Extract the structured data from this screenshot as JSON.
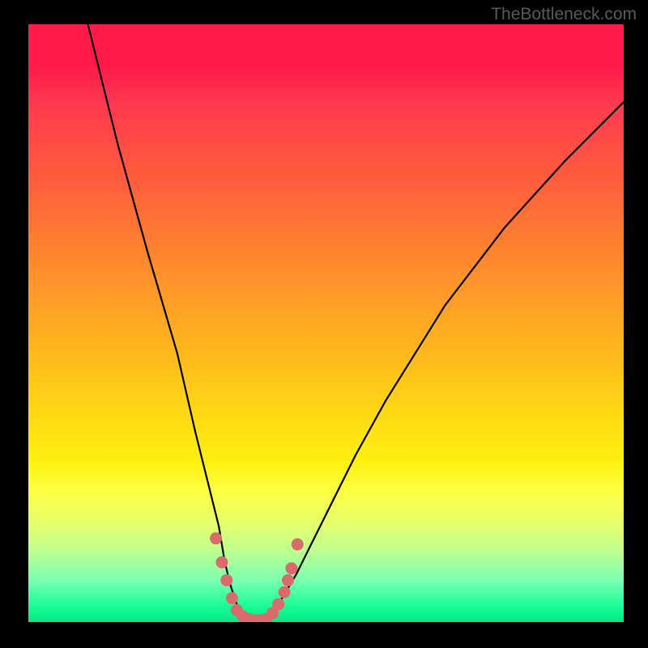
{
  "watermark": "TheBottleneck.com",
  "chart_data": {
    "type": "line",
    "title": "",
    "xlabel": "",
    "ylabel": "",
    "xlim": [
      0,
      100
    ],
    "ylim": [
      0,
      100
    ],
    "gradient": {
      "top_color": "#ff1a4a",
      "mid_color": "#fff010",
      "bottom_color": "#00e886"
    },
    "curve": {
      "description": "V-shaped bottleneck curve with minimum region",
      "x": [
        10,
        15,
        20,
        25,
        28,
        30,
        32,
        33,
        34,
        35,
        36,
        37,
        38,
        39,
        40,
        42,
        45,
        50,
        55,
        60,
        70,
        80,
        90,
        100
      ],
      "y": [
        100,
        80,
        62,
        45,
        32,
        24,
        16,
        10,
        6,
        3,
        1,
        0,
        0,
        0,
        0,
        3,
        8,
        18,
        28,
        37,
        53,
        66,
        77,
        87
      ]
    },
    "minimum_markers": {
      "description": "Pink dotted markers near curve minimum",
      "points": [
        {
          "x": 31.5,
          "y": 14
        },
        {
          "x": 32.5,
          "y": 10
        },
        {
          "x": 33.3,
          "y": 7
        },
        {
          "x": 34.2,
          "y": 4
        },
        {
          "x": 35.0,
          "y": 2
        },
        {
          "x": 36.0,
          "y": 1
        },
        {
          "x": 37.0,
          "y": 0.5
        },
        {
          "x": 38.0,
          "y": 0.3
        },
        {
          "x": 39.0,
          "y": 0.3
        },
        {
          "x": 40.0,
          "y": 0.5
        },
        {
          "x": 41.0,
          "y": 1.5
        },
        {
          "x": 42.0,
          "y": 3
        },
        {
          "x": 43.0,
          "y": 5
        },
        {
          "x": 43.6,
          "y": 7
        },
        {
          "x": 44.2,
          "y": 9
        },
        {
          "x": 45.2,
          "y": 13
        }
      ],
      "color": "#d96b6b"
    }
  }
}
